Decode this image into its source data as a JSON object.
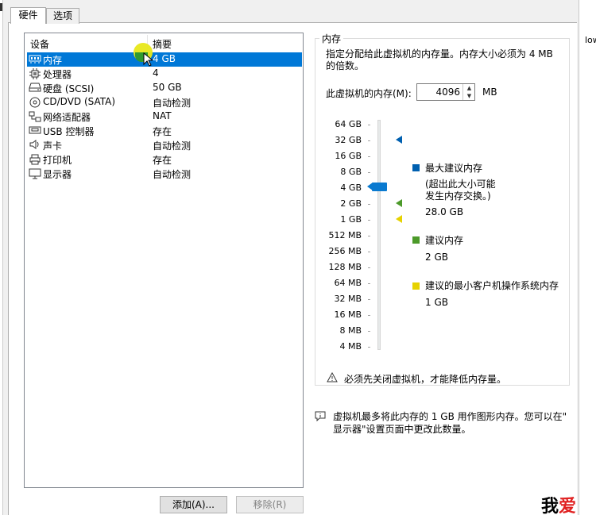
{
  "window": {
    "right_strip_text": "low"
  },
  "tabs": [
    {
      "label": "硬件",
      "active": true
    },
    {
      "label": "选项",
      "active": false
    }
  ],
  "device_list": {
    "columns": {
      "device": "设备",
      "summary": "摘要"
    },
    "rows": [
      {
        "icon": "memory-icon",
        "name": "内存",
        "summary": "4 GB",
        "selected": true
      },
      {
        "icon": "cpu-icon",
        "name": "处理器",
        "summary": "4"
      },
      {
        "icon": "harddisk-icon",
        "name": "硬盘 (SCSI)",
        "summary": "50 GB"
      },
      {
        "icon": "cdrom-icon",
        "name": "CD/DVD (SATA)",
        "summary": "自动检测"
      },
      {
        "icon": "network-icon",
        "name": "网络适配器",
        "summary": "NAT"
      },
      {
        "icon": "usb-icon",
        "name": "USB 控制器",
        "summary": "存在"
      },
      {
        "icon": "speaker-icon",
        "name": "声卡",
        "summary": "自动检测"
      },
      {
        "icon": "printer-icon",
        "name": "打印机",
        "summary": "存在"
      },
      {
        "icon": "monitor-icon",
        "name": "显示器",
        "summary": "自动检测"
      }
    ]
  },
  "buttons": {
    "add": "添加(A)...",
    "remove": "移除(R)"
  },
  "memory": {
    "group_title": "内存",
    "description": "指定分配给此虚拟机的内存量。内存大小必须为 4 MB 的倍数。",
    "field_label": "此虚拟机的内存(M):",
    "value": "4096",
    "unit": "MB",
    "scale": [
      "64 GB",
      "32 GB",
      "16 GB",
      "8 GB",
      "4 GB",
      "2 GB",
      "1 GB",
      "512 MB",
      "256 MB",
      "128 MB",
      "64 MB",
      "32 MB",
      "16 MB",
      "8 MB",
      "4 MB"
    ],
    "slider_value": "4 GB",
    "legend": {
      "max": {
        "label": "最大建议内存",
        "note_line1": "(超出此大小可能",
        "note_line2": "发生内存交换。)",
        "value": "28.0 GB",
        "color": "#0060b0"
      },
      "recommended": {
        "label": "建议内存",
        "value": "2 GB",
        "color": "#4c9a2a"
      },
      "min": {
        "label": "建议的最小客户机操作系统内存",
        "value": "1 GB",
        "color": "#e6d200"
      }
    },
    "warning": "必须先关闭虚拟机，才能降低内存量。"
  },
  "info_note": {
    "line1": "虚拟机最多将此内存的 1 GB 用作图形内存。您可以在\"",
    "line2": "显示器\"设置页面中更改此数量。"
  },
  "watermark": {
    "char1": "我",
    "char2": "爱"
  }
}
